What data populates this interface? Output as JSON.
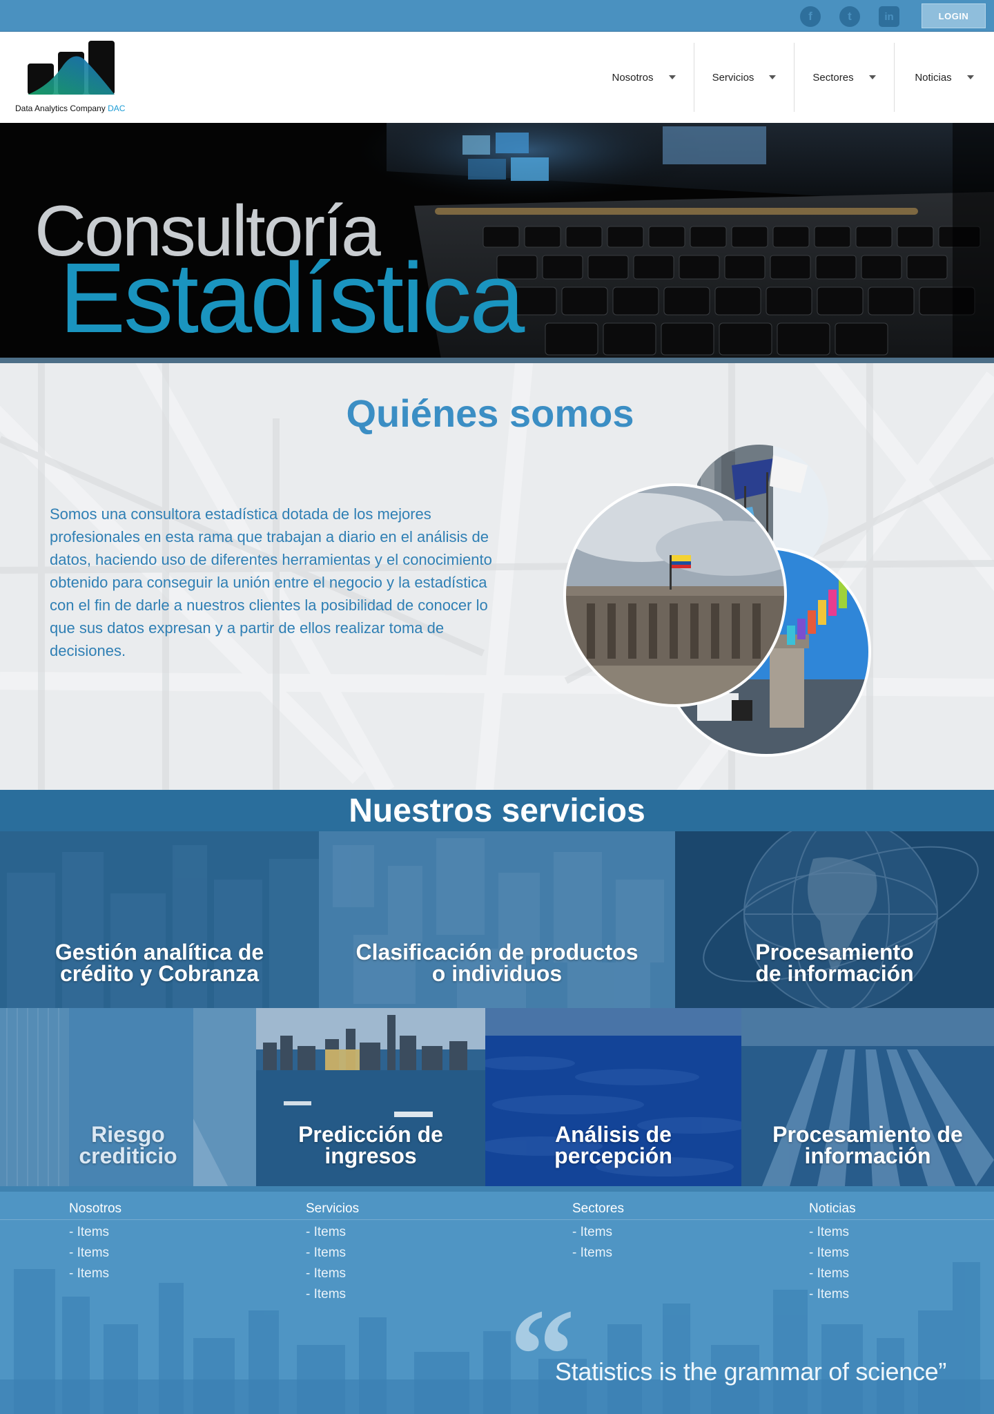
{
  "topbar": {
    "social": [
      {
        "name": "facebook",
        "glyph": "f"
      },
      {
        "name": "twitter",
        "glyph": "t"
      },
      {
        "name": "linkedin",
        "glyph": "in"
      }
    ],
    "login_label": "LOGIN"
  },
  "header": {
    "logo_text": "Data Analytics Company",
    "logo_accent": "DAC",
    "nav": [
      {
        "label": "Nosotros"
      },
      {
        "label": "Servicios"
      },
      {
        "label": "Sectores"
      },
      {
        "label": "Noticias"
      }
    ]
  },
  "hero": {
    "line1": "Consultoría",
    "line2": "Estadística"
  },
  "about": {
    "title": "Quiénes somos",
    "text": "Somos una consultora estadística dotada de los mejores profesionales en esta rama que trabajan a diario en el análisis de datos, haciendo uso de diferentes herramientas y el conocimiento obtenido para conseguir la unión entre el negocio y la estadística con el fin de darle a nuestros clientes la posibilidad de conocer lo que sus datos expresan y a partir de ellos realizar toma de decisiones."
  },
  "services": {
    "title": "Nuestros servicios",
    "top": [
      {
        "line1": "Gestión analítica de",
        "line2": "crédito y Cobranza"
      },
      {
        "line1": "Clasificación de productos",
        "line2": "o individuos"
      },
      {
        "line1": "Procesamiento",
        "line2": "de información"
      }
    ],
    "bottom": [
      {
        "line1": "Riesgo",
        "line2": "crediticio"
      },
      {
        "line1": "Predicción de",
        "line2": "ingresos"
      },
      {
        "line1": "Análisis de",
        "line2": "percepción"
      },
      {
        "line1": "Procesamiento de",
        "line2": "información"
      }
    ]
  },
  "footer": {
    "columns": [
      {
        "title": "Nosotros",
        "items": [
          "- Items",
          "- Items",
          "- Items"
        ]
      },
      {
        "title": "Servicios",
        "items": [
          "- Items",
          "- Items",
          "- Items",
          "- Items"
        ]
      },
      {
        "title": "Sectores",
        "items": [
          "- Items",
          "- Items"
        ]
      },
      {
        "title": "Noticias",
        "items": [
          "- Items",
          "- Items",
          "- Items",
          "- Items"
        ]
      }
    ],
    "quote": "Statistics is the grammar of science”"
  },
  "colors": {
    "brand_blue": "#4a91c0",
    "title_blue": "#3b8ec4",
    "hero_teal": "#1a94bf",
    "services_bar": "#2a6e9c"
  }
}
